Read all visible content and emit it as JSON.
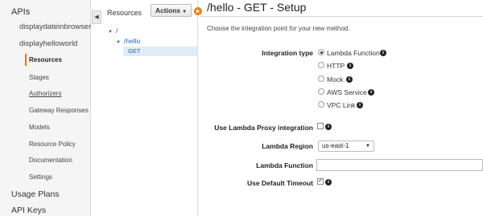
{
  "sidebar": {
    "apis_label": "APIs",
    "api_items": [
      "displaydateinbrowser",
      "displayhelloworld"
    ],
    "sub_items": [
      "Resources",
      "Stages",
      "Authorizers",
      "Gateway Responses",
      "Models",
      "Resource Policy",
      "Documentation",
      "Settings"
    ],
    "bottom_items": [
      "Usage Plans",
      "API Keys"
    ],
    "collapse_glyph": "◀"
  },
  "resources": {
    "title": "Resources",
    "actions_label": "Actions",
    "tree": {
      "root": "/",
      "child": "/hello",
      "method": "GET"
    }
  },
  "main": {
    "title": "/hello - GET - Setup",
    "intro": "Choose the integration point for your new method.",
    "integration_type_label": "Integration type",
    "integration_options": [
      {
        "label": "Lambda Function",
        "selected": true
      },
      {
        "label": "HTTP",
        "selected": false
      },
      {
        "label": "Mock",
        "selected": false
      },
      {
        "label": "AWS Service",
        "selected": false
      },
      {
        "label": "VPC Link",
        "selected": false
      }
    ],
    "proxy_label": "Use Lambda Proxy integration",
    "proxy_checked": false,
    "region_label": "Lambda Region",
    "region_value": "us-east-1",
    "function_label": "Lambda Function",
    "function_value": "",
    "timeout_label": "Use Default Timeout",
    "timeout_checked": true
  },
  "colors": {
    "accent_orange": "#ec7211",
    "link_blue": "#1e6bb8",
    "selected_row": "#dfecf7"
  }
}
